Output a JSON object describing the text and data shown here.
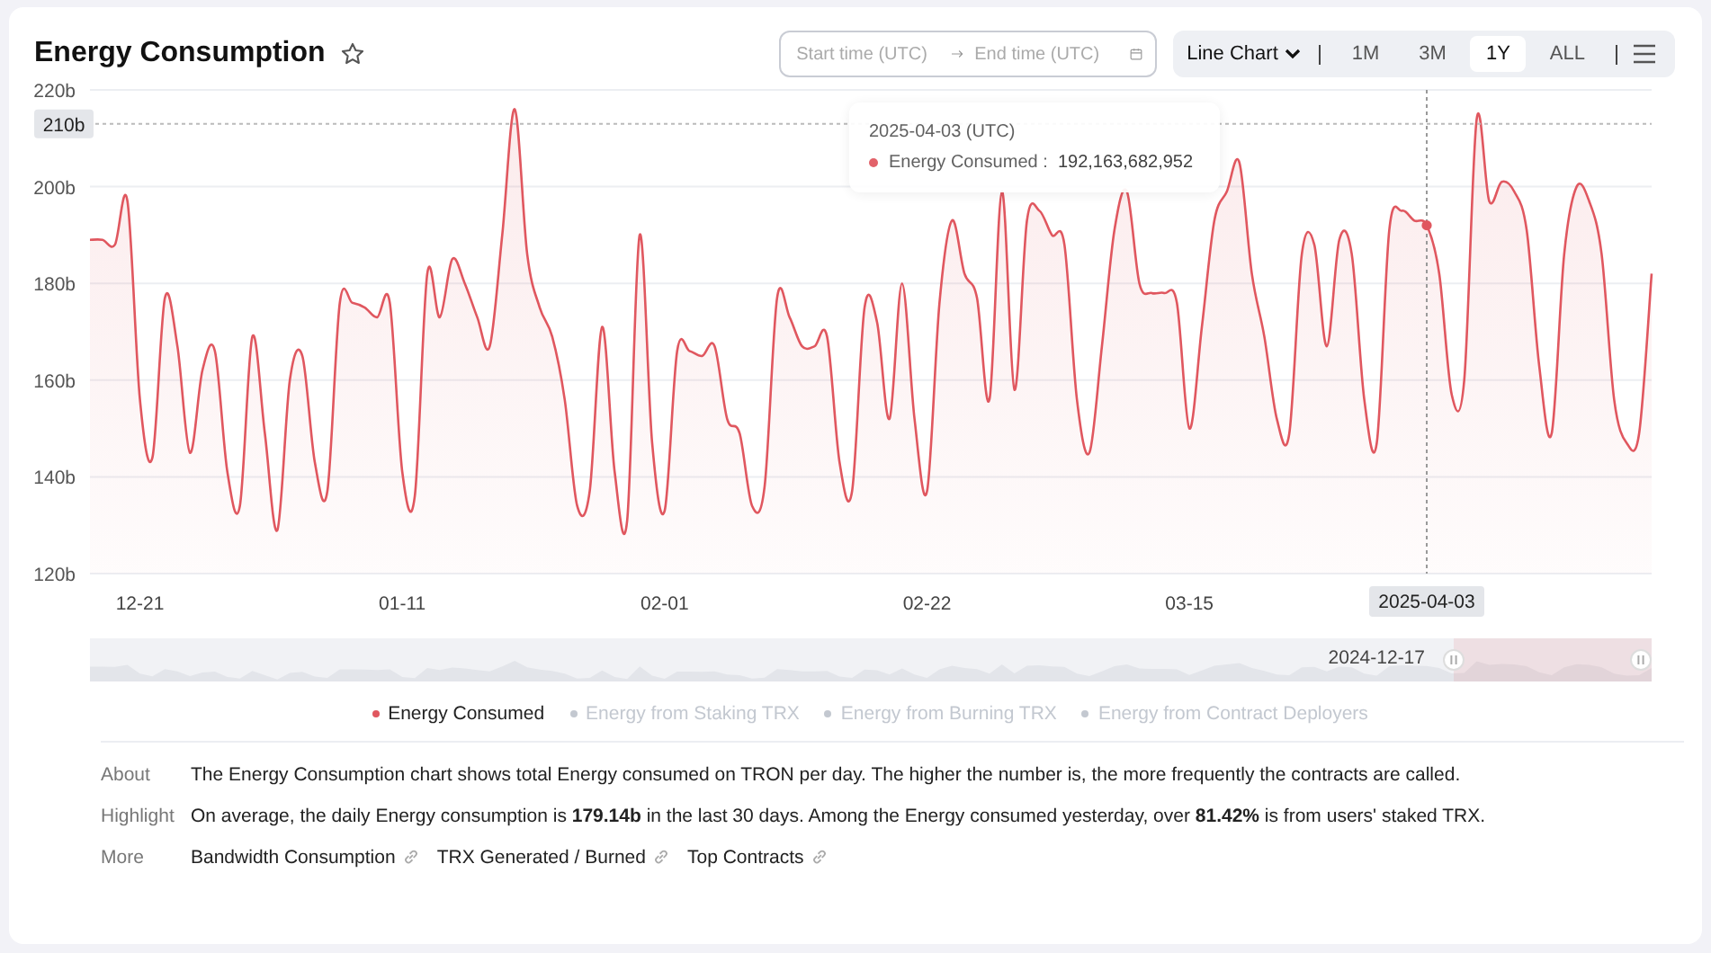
{
  "header": {
    "title": "Energy Consumption",
    "favorite": false,
    "start_placeholder": "Start time (UTC)",
    "end_placeholder": "End time (UTC)",
    "chart_type": "Line Chart",
    "ranges": [
      {
        "label": "1M",
        "selected": false
      },
      {
        "label": "3M",
        "selected": false
      },
      {
        "label": "1Y",
        "selected": true
      },
      {
        "label": "ALL",
        "selected": false
      }
    ]
  },
  "chart": {
    "chart_data": {
      "type": "area",
      "grid": true,
      "ylim": [
        120,
        220
      ],
      "yticks": [
        {
          "value": 120,
          "label": "120b"
        },
        {
          "value": 140,
          "label": "140b"
        },
        {
          "value": 160,
          "label": "160b"
        },
        {
          "value": 180,
          "label": "180b"
        },
        {
          "value": 200,
          "label": "200b"
        },
        {
          "value": 220,
          "label": "220b"
        }
      ],
      "categories": [
        null,
        null,
        null,
        null,
        "12-21",
        null,
        null,
        null,
        null,
        null,
        null,
        null,
        null,
        null,
        null,
        null,
        null,
        null,
        null,
        null,
        null,
        null,
        null,
        null,
        null,
        "01-11",
        null,
        null,
        null,
        null,
        null,
        null,
        null,
        null,
        null,
        null,
        null,
        null,
        null,
        null,
        null,
        null,
        null,
        null,
        null,
        null,
        "02-01",
        null,
        null,
        null,
        null,
        null,
        null,
        null,
        null,
        null,
        null,
        null,
        null,
        null,
        null,
        null,
        null,
        null,
        null,
        null,
        null,
        "02-22",
        null,
        null,
        null,
        null,
        null,
        null,
        null,
        null,
        null,
        null,
        null,
        null,
        null,
        null,
        null,
        null,
        null,
        null,
        null,
        null,
        "03-15",
        null,
        null,
        null,
        null,
        null,
        null,
        null,
        null,
        null,
        null,
        null,
        null,
        null,
        null,
        null,
        null,
        null,
        null,
        "2025-04-03",
        null,
        null,
        null,
        null,
        null,
        null,
        null,
        null,
        null,
        null,
        null,
        null,
        null,
        null,
        null,
        null,
        null,
        null
      ],
      "ref_lines": [
        {
          "axis": "y",
          "value": 213,
          "label": "210b"
        }
      ],
      "series": [
        {
          "name": "Energy Consumed",
          "color": "#e0575f",
          "values": [
            189,
            189,
            188,
            197,
            156,
            144,
            177,
            167,
            145,
            162,
            166,
            141,
            134,
            169,
            149,
            129,
            160,
            165,
            143,
            137,
            176,
            176,
            175,
            173,
            176,
            141,
            136,
            182,
            173,
            185,
            180,
            173,
            167,
            190,
            216,
            186,
            175,
            169,
            156,
            134,
            137,
            171,
            141,
            131,
            190,
            147,
            133,
            166,
            166,
            165,
            167,
            152,
            149,
            134,
            138,
            177,
            173,
            167,
            167,
            169,
            143,
            137,
            175,
            172,
            152,
            180,
            152,
            137,
            176,
            193,
            182,
            177,
            156,
            199,
            158,
            193,
            195,
            190,
            188,
            156,
            145,
            167,
            191,
            199,
            180,
            178,
            178,
            176,
            150,
            171,
            193,
            199,
            205,
            182,
            169,
            152,
            149,
            186,
            188,
            167,
            189,
            186,
            156,
            147,
            191,
            195,
            193,
            192,
            182,
            157,
            160,
            214,
            197,
            201,
            199,
            191,
            163,
            149,
            186,
            200,
            197,
            186,
            156,
            147,
            149,
            182
          ]
        }
      ]
    },
    "tooltip": {
      "date": "2025-04-03 (UTC)",
      "label": "Energy Consumed :",
      "value": "192,163,682,952"
    },
    "navigator": {
      "start_label": "2024-12-17"
    },
    "legend": [
      {
        "label": "Energy from Staking TRX",
        "active": false
      },
      {
        "label": "Energy from Burning TRX",
        "active": false
      },
      {
        "label": "Energy from Contract Deployers",
        "active": false
      }
    ]
  },
  "info": {
    "rows": [
      {
        "label": "About",
        "kind": "text",
        "text": "The Energy Consumption chart shows total Energy consumed on TRON per day. The higher the number is, the more frequently the contracts are called."
      },
      {
        "label": "Highlight",
        "kind": "text",
        "text": "On average, the daily Energy consumption is **179.14b** in the last 30 days.  Among the Energy consumed yesterday, over **81.42%** is from users' staked TRX."
      },
      {
        "label": "More",
        "kind": "links",
        "links": [
          "Bandwidth Consumption",
          "TRX Generated / Burned",
          "Top Contracts"
        ]
      }
    ]
  }
}
